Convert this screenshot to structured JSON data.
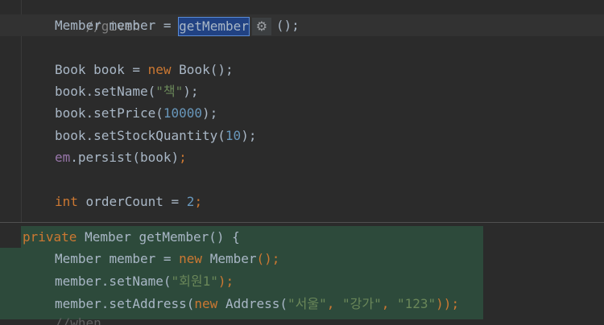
{
  "editor": {
    "line_comment": "//given",
    "line_member": {
      "type": "Member",
      "var": "member",
      "op": "=",
      "selected": "getMember",
      "rest": "();"
    },
    "line_book_decl": {
      "type": "Book",
      "var": "book",
      "op": "=",
      "kw_new": "new",
      "ctor": "Book",
      "rest": "();"
    },
    "line_setname": {
      "target": "book",
      "method": ".setName(",
      "arg": "\"책\"",
      "end": ");"
    },
    "line_setprice": {
      "target": "book",
      "method": ".setPrice(",
      "arg": "10000",
      "end": ");"
    },
    "line_setstock": {
      "target": "book",
      "method": ".setStockQuantity(",
      "arg": "10",
      "end": ");"
    },
    "line_persist": {
      "field": "em",
      "method": ".persist(book)",
      "end": ";"
    },
    "line_ordercount": {
      "kw": "int",
      "var": "orderCount",
      "op": "=",
      "num": "2",
      "end": ";"
    }
  },
  "preview": {
    "line1": {
      "kw": "private",
      "type": "Member",
      "sig": "getMember() {"
    },
    "line2": {
      "type": "Member",
      "var": "member",
      "op": "=",
      "kw_new": "new",
      "ctor": "Member",
      "rest": "();"
    },
    "line3": {
      "target": "member",
      "method": ".setName(",
      "arg": "\"회원1\"",
      "end": ");"
    },
    "line4": {
      "target": "member",
      "method": ".setAddress(",
      "kw_new": "new",
      "ctor": "Address(",
      "arg1": "\"서울\"",
      "arg2": "\"강가\"",
      "arg3": "\"123\"",
      "end": "));",
      "sep": ","
    },
    "ghost": "//when"
  },
  "colors": {
    "background": "#2b2b2b",
    "keyword": "#cc7832",
    "number": "#6897bb",
    "string": "#6a8759",
    "field": "#9876aa",
    "selection": "#214283",
    "preview_bg": "#2d4a3b"
  },
  "icons": {
    "settings": "gear-icon"
  }
}
